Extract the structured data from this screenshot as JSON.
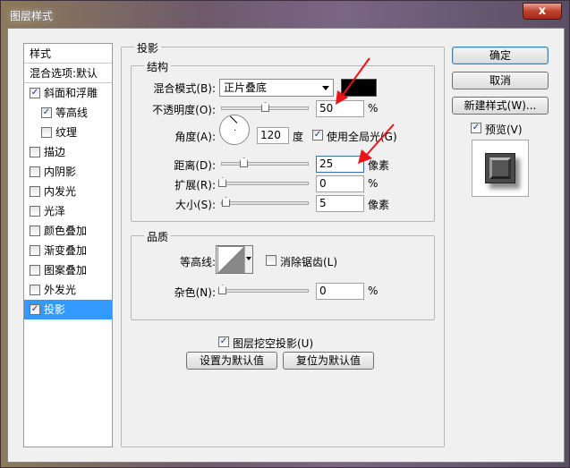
{
  "window": {
    "title": "图层样式",
    "close_glyph": "x"
  },
  "style_list": {
    "header": "样式",
    "blend_options": "混合选项:默认",
    "items": [
      {
        "label": "斜面和浮雕",
        "checked": true,
        "sub": false,
        "active": false
      },
      {
        "label": "等高线",
        "checked": true,
        "sub": true,
        "active": false
      },
      {
        "label": "纹理",
        "checked": false,
        "sub": true,
        "active": false
      },
      {
        "label": "描边",
        "checked": false,
        "sub": false,
        "active": false
      },
      {
        "label": "内阴影",
        "checked": false,
        "sub": false,
        "active": false
      },
      {
        "label": "内发光",
        "checked": false,
        "sub": false,
        "active": false
      },
      {
        "label": "光泽",
        "checked": false,
        "sub": false,
        "active": false
      },
      {
        "label": "颜色叠加",
        "checked": false,
        "sub": false,
        "active": false
      },
      {
        "label": "渐变叠加",
        "checked": false,
        "sub": false,
        "active": false
      },
      {
        "label": "图案叠加",
        "checked": false,
        "sub": false,
        "active": false
      },
      {
        "label": "外发光",
        "checked": false,
        "sub": false,
        "active": false
      },
      {
        "label": "投影",
        "checked": true,
        "sub": false,
        "active": true
      }
    ]
  },
  "drop_shadow": {
    "section_title": "投影",
    "structure": {
      "title": "结构",
      "blend_mode_label": "混合模式(B):",
      "blend_mode_value": "正片叠底",
      "shadow_color": "#000000",
      "opacity_label": "不透明度(O):",
      "opacity_value": "50",
      "opacity_fraction": 0.5,
      "percent": "%",
      "angle_label": "角度(A):",
      "angle_value": "120",
      "angle_unit": "度",
      "global_light_label": "使用全局光(G)",
      "global_light_checked": true,
      "distance_label": "距离(D):",
      "distance_value": "25",
      "spread_label": "扩展(R):",
      "spread_value": "0",
      "size_label": "大小(S):",
      "size_value": "5",
      "px_unit": "像素"
    },
    "quality": {
      "title": "品质",
      "contour_label": "等高线:",
      "antialias_label": "消除锯齿(L)",
      "antialias_checked": false,
      "noise_label": "杂色(N):",
      "noise_value": "0",
      "percent": "%"
    },
    "knockout_label": "图层挖空投影(U)",
    "knockout_checked": true,
    "make_default_label": "设置为默认值",
    "reset_default_label": "复位为默认值"
  },
  "buttons": {
    "ok": "确定",
    "cancel": "取消",
    "new_style": "新建样式(W)...",
    "preview_label": "预览(V)",
    "preview_checked": true
  },
  "colors": {
    "selection": "#3399ff",
    "annotation_arrow": "#e8141a"
  },
  "icons": {
    "check": "check-icon",
    "dropdown": "chevron-down-icon",
    "close": "close-icon"
  }
}
